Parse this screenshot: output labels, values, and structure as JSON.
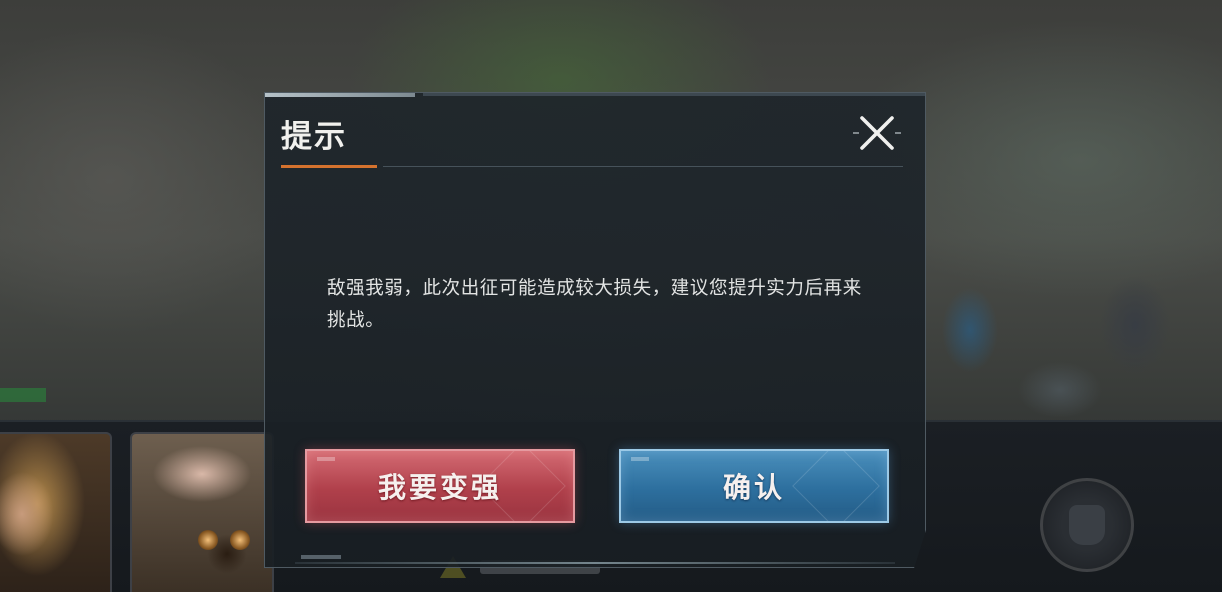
{
  "dialog": {
    "title": "提示",
    "message": "敌强我弱，此次出征可能造成较大损失，建议您提升实力后再来挑战。",
    "buttons": {
      "become_stronger": "我要变强",
      "confirm": "确认"
    },
    "close_icon": "close-x-icon"
  },
  "colors": {
    "title_accent": "#d4722e",
    "strong_button": "#b0404b",
    "confirm_button": "#2d6f9e",
    "dialog_bg": "#1e252b"
  }
}
